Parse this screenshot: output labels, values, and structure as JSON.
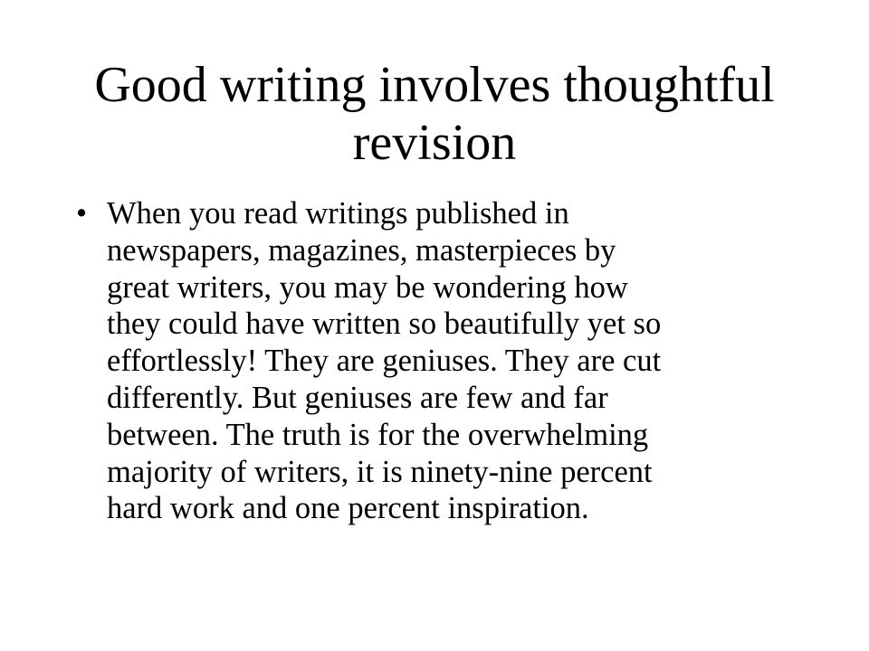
{
  "slide": {
    "title": "Good writing involves thoughtful revision",
    "bullets": [
      {
        "marker": "•",
        "lines": [
          "When you read writings published in",
          "newspapers, magazines, masterpieces by",
          "great writers, you may be wondering how",
          "they could have written so beautifully yet so",
          "effortlessly! They are geniuses. They are cut",
          "differently. But geniuses are few and far",
          "between. The truth is for the overwhelming",
          "majority of writers, it is ninety-nine percent",
          "hard work and one percent inspiration."
        ]
      }
    ]
  }
}
